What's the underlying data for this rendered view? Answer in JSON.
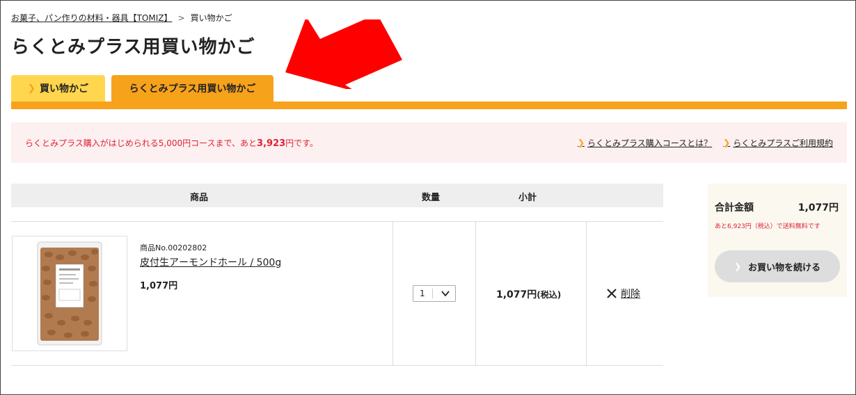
{
  "breadcrumb": {
    "home": "お菓子、パン作りの材料・器具【TOMIZ】",
    "separator": ">",
    "current": "買い物かご"
  },
  "page_title": "らくとみプラス用買い物かご",
  "tabs": [
    {
      "label": "買い物かご",
      "active": false
    },
    {
      "label": "らくとみプラス用買い物かご",
      "active": true
    }
  ],
  "notice": {
    "text_before": "らくとみプラス購入がはじめられる5,000円コースまで、あと",
    "amount": "3,923",
    "text_after": "円です。",
    "links": [
      {
        "label": "らくとみプラス購入コースとは？"
      },
      {
        "label": "らくとみプラスご利用規約"
      }
    ]
  },
  "table": {
    "headers": {
      "product": "商品",
      "quantity": "数量",
      "subtotal": "小計"
    },
    "items": [
      {
        "product_no": "商品No.00202802",
        "name": "皮付生アーモンドホール / 500g",
        "price": "1,077円",
        "quantity": "1",
        "subtotal": "1,077円",
        "tax_note": "(税込)",
        "delete_label": "削除"
      }
    ]
  },
  "summary": {
    "total_label": "合計金額",
    "total_value": "1,077円",
    "shipping_note": "あと6,923円（税込）で送料無料です",
    "continue_label": "お買い物を続ける"
  },
  "colors": {
    "tab_orange": "#f7a21b",
    "tab_yellow": "#ffd64d",
    "arrow_red": "#ff0000",
    "notice_red": "#dd2233"
  },
  "icons": [
    "chevron-right-icon",
    "chevron-down-icon",
    "close-icon",
    "red-arrow-annotation"
  ]
}
